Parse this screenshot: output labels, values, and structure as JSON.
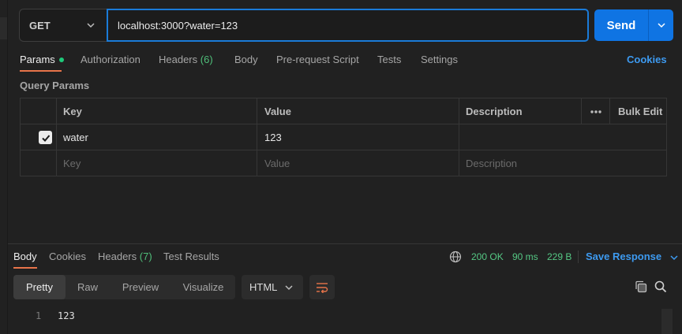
{
  "request": {
    "method": "GET",
    "url": "localhost:3000?water=123",
    "send_label": "Send"
  },
  "request_tabs": {
    "params": "Params",
    "authorization": "Authorization",
    "headers": "Headers",
    "headers_count": "(6)",
    "body": "Body",
    "prerequest": "Pre-request Script",
    "tests": "Tests",
    "settings": "Settings",
    "cookies": "Cookies"
  },
  "query_params": {
    "title": "Query Params",
    "columns": {
      "key": "Key",
      "value": "Value",
      "description": "Description",
      "bulk_edit": "Bulk Edit"
    },
    "rows": [
      {
        "checked": true,
        "key": "water",
        "value": "123",
        "description": ""
      }
    ],
    "placeholder": {
      "key": "Key",
      "value": "Value",
      "description": "Description"
    }
  },
  "response_tabs": {
    "body": "Body",
    "cookies": "Cookies",
    "headers": "Headers",
    "headers_count": "(7)",
    "test_results": "Test Results"
  },
  "response_status": {
    "code": "200 OK",
    "time": "90 ms",
    "size": "229 B",
    "save_label": "Save Response"
  },
  "view_modes": {
    "pretty": "Pretty",
    "raw": "Raw",
    "preview": "Preview",
    "visualize": "Visualize"
  },
  "format": "HTML",
  "response_body": {
    "line_number": "1",
    "content": "123"
  },
  "colors": {
    "accent": "#0f74e3",
    "link": "#3d9af0",
    "tab_underline": "#e8744a",
    "status_ok": "#55c884"
  }
}
